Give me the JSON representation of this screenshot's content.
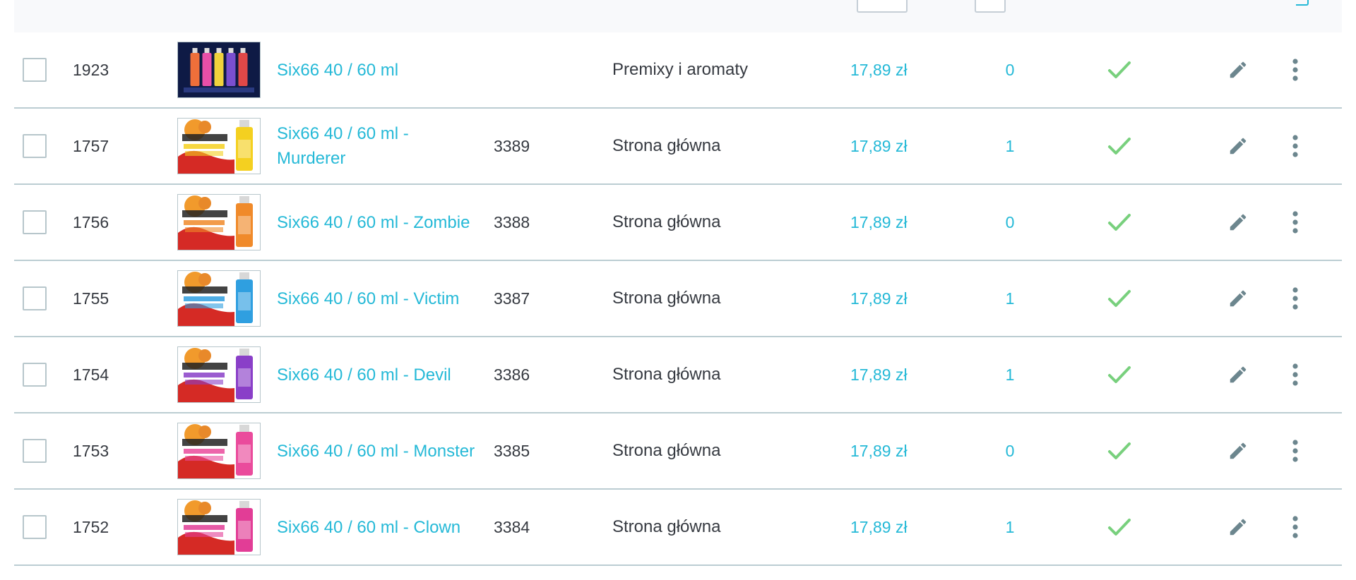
{
  "colors": {
    "link": "#25b9d7",
    "text": "#363a41",
    "check": "#78d07d",
    "border": "#bbcdd2",
    "icon": "#6c868e"
  },
  "icons": {
    "status": "check-icon",
    "edit": "pencil-icon",
    "more": "more-vertical-icon"
  },
  "products": [
    {
      "id": "1923",
      "name": "Six66 40 / 60 ml",
      "reference": "",
      "category": "Premixy i aromaty",
      "price": "17,89 zł",
      "quantity": "0",
      "thumb": {
        "label": "",
        "bg": "#0e1a45",
        "bottles": [
          "#ee6f3a",
          "#e94fa8",
          "#f0d23c",
          "#7a4fd0",
          "#e04848"
        ]
      }
    },
    {
      "id": "1757",
      "name": "Six66 40 / 60 ml - Murderer",
      "reference": "3389",
      "category": "Strona główna",
      "price": "17,89 zł",
      "quantity": "1",
      "thumb": {
        "label": "MURDERER",
        "bg": "#ffffff",
        "bottles": [
          "#f4d020"
        ]
      }
    },
    {
      "id": "1756",
      "name": "Six66 40 / 60 ml - Zombie",
      "reference": "3388",
      "category": "Strona główna",
      "price": "17,89 zł",
      "quantity": "0",
      "thumb": {
        "label": "ZOMBIE",
        "bg": "#ffffff",
        "bottles": [
          "#f08a2a"
        ]
      }
    },
    {
      "id": "1755",
      "name": "Six66 40 / 60 ml - Victim",
      "reference": "3387",
      "category": "Strona główna",
      "price": "17,89 zł",
      "quantity": "1",
      "thumb": {
        "label": "VICTIM",
        "bg": "#ffffff",
        "bottles": [
          "#2f9fe0"
        ]
      }
    },
    {
      "id": "1754",
      "name": "Six66 40 / 60 ml - Devil",
      "reference": "3386",
      "category": "Strona główna",
      "price": "17,89 zł",
      "quantity": "1",
      "thumb": {
        "label": "DEVIL",
        "bg": "#ffffff",
        "bottles": [
          "#8a3fc8"
        ]
      }
    },
    {
      "id": "1753",
      "name": "Six66 40 / 60 ml - Monster",
      "reference": "3385",
      "category": "Strona główna",
      "price": "17,89 zł",
      "quantity": "0",
      "thumb": {
        "label": "MONSTER",
        "bg": "#ffffff",
        "bottles": [
          "#ea4b9c"
        ]
      }
    },
    {
      "id": "1752",
      "name": "Six66 40 / 60 ml - Clown",
      "reference": "3384",
      "category": "Strona główna",
      "price": "17,89 zł",
      "quantity": "1",
      "thumb": {
        "label": "CLOWN",
        "bg": "#ffffff",
        "bottles": [
          "#e23d96"
        ]
      }
    }
  ]
}
